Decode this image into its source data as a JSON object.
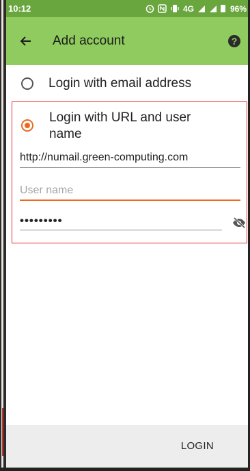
{
  "status_bar": {
    "time": "10:12",
    "icons": [
      "alarm-icon",
      "nfc-icon",
      "vibrate-icon",
      "network-4g-icon",
      "signal-icon",
      "signal-icon",
      "battery-icon"
    ],
    "network_label": "4G",
    "battery": "96%"
  },
  "app_bar": {
    "title": "Add account",
    "back_icon": "arrow-back-icon",
    "help_icon": "help-icon",
    "help_glyph": "?"
  },
  "options": {
    "email_label": "Login with email address",
    "url_label": "Login with URL and user name"
  },
  "fields": {
    "url_value": "http://numail.green-computing.com",
    "username_placeholder": "User name",
    "password_value": "•••••••••"
  },
  "actions": {
    "login_label": "LOGIN"
  },
  "colors": {
    "status_bar": "#6aa63e",
    "app_bar": "#8fcb5e",
    "accent": "#ea6a1f",
    "highlight_border": "#e03030"
  }
}
